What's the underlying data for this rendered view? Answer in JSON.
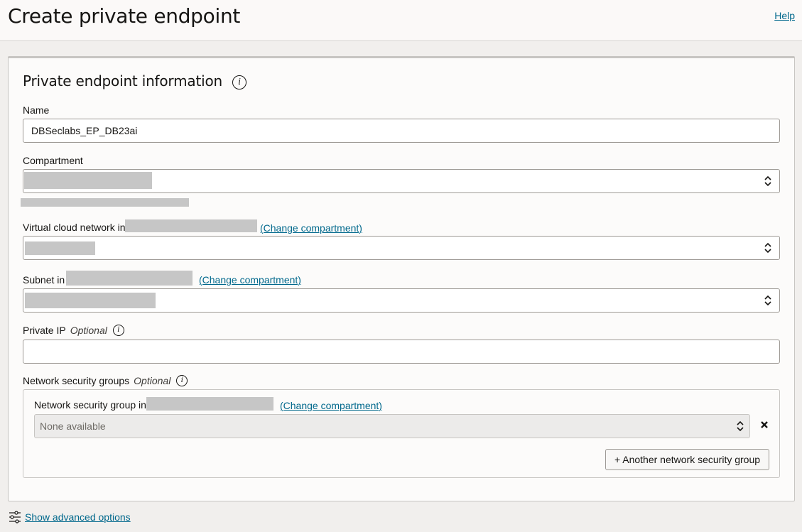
{
  "header": {
    "title": "Create private endpoint",
    "help_label": "Help"
  },
  "section": {
    "title": "Private endpoint information",
    "info_icon": "info-icon"
  },
  "name_field": {
    "label": "Name",
    "value": "DBSeclabs_EP_DB23ai"
  },
  "compartment_field": {
    "label": "Compartment",
    "value": "",
    "arrow_icon": "chevron-up-down-icon"
  },
  "vcn_field": {
    "label": "Virtual cloud network in",
    "change_label": "(Change compartment)",
    "value": "",
    "arrow_icon": "chevron-up-down-icon"
  },
  "subnet_field": {
    "label": "Subnet in",
    "change_label": "(Change compartment)",
    "value": "",
    "arrow_icon": "chevron-up-down-icon"
  },
  "private_ip_field": {
    "label": "Private IP",
    "optional": "Optional",
    "value": "",
    "info_icon": "info-icon"
  },
  "nsg": {
    "label": "Network security groups",
    "optional": "Optional",
    "info_icon": "info-icon",
    "group_label": "Network security group in",
    "change_label": "(Change compartment)",
    "select_value": "None available",
    "remove_icon": "close-icon",
    "add_button": "+ Another network security group"
  },
  "advanced": {
    "label": "Show advanced options",
    "icon": "sliders-icon"
  },
  "colors": {
    "link": "#00688c",
    "redaction": "#c6c6c6"
  }
}
